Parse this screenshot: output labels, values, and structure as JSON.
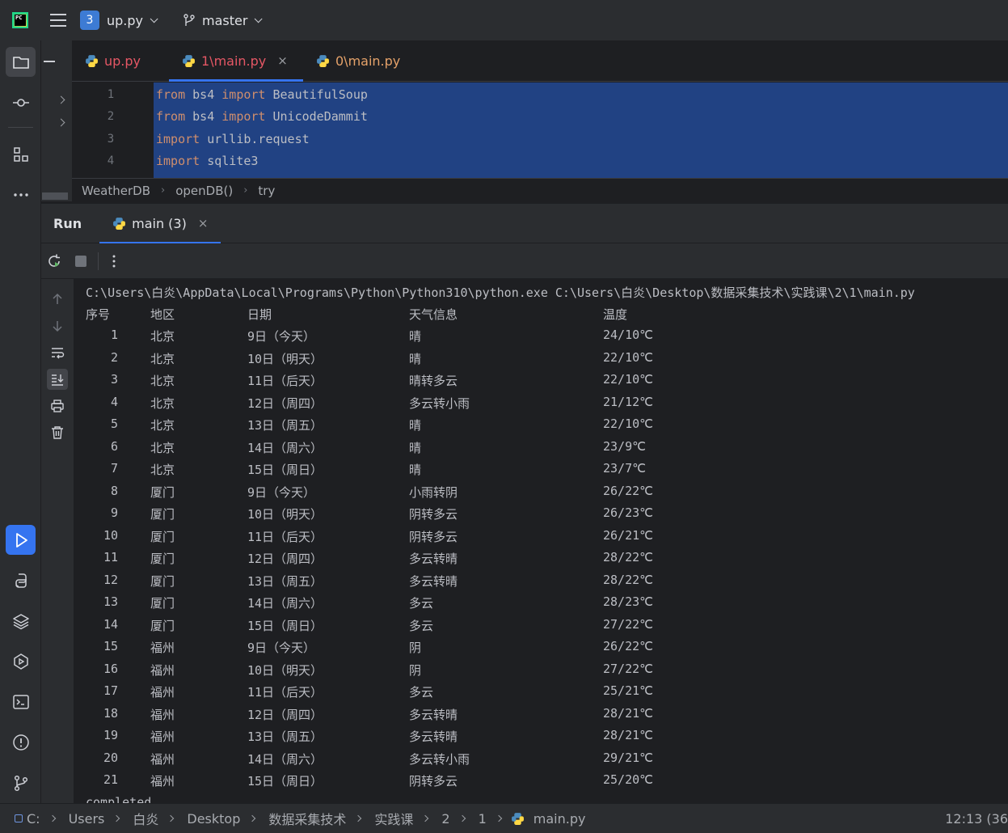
{
  "titlebar": {
    "logo_text": "PC",
    "project_badge": "3",
    "project_name": "up.py",
    "branch": "master"
  },
  "editor": {
    "tabs": [
      {
        "label": "up.py",
        "color": "#e55765",
        "active": false
      },
      {
        "label": "1\\main.py",
        "color": "#e55765",
        "active": true
      },
      {
        "label": "0\\main.py",
        "color": "#e5a26a",
        "active": false
      }
    ],
    "tab_close": "×",
    "line_numbers": [
      "1",
      "2",
      "3",
      "4"
    ],
    "lines": [
      {
        "kw1": "from",
        "mid": " bs4 ",
        "kw2": "import",
        "rest": " BeautifulSoup"
      },
      {
        "kw1": "from",
        "mid": " bs4 ",
        "kw2": "import",
        "rest": " UnicodeDammit"
      },
      {
        "kw1": "import",
        "rest": " urllib.request"
      },
      {
        "kw1": "import",
        "rest": " sqlite3"
      }
    ],
    "breadcrumbs": [
      "WeatherDB",
      "openDB()",
      "try"
    ]
  },
  "run": {
    "title": "Run",
    "tab_label": "main (3)",
    "tab_close": "×",
    "command": "C:\\Users\\白炎\\AppData\\Local\\Programs\\Python\\Python310\\python.exe C:\\Users\\白炎\\Desktop\\数据采集技术\\实践课\\2\\1\\main.py",
    "headers": {
      "idx": "序号",
      "city": "地区",
      "date": "日期",
      "weather": "天气信息",
      "temp": "温度"
    },
    "rows": [
      {
        "idx": "1",
        "city": "北京",
        "date": "9日（今天）",
        "weather": "晴",
        "temp": "24/10℃"
      },
      {
        "idx": "2",
        "city": "北京",
        "date": "10日（明天）",
        "weather": "晴",
        "temp": "22/10℃"
      },
      {
        "idx": "3",
        "city": "北京",
        "date": "11日（后天）",
        "weather": "晴转多云",
        "temp": "22/10℃"
      },
      {
        "idx": "4",
        "city": "北京",
        "date": "12日（周四）",
        "weather": "多云转小雨",
        "temp": "21/12℃"
      },
      {
        "idx": "5",
        "city": "北京",
        "date": "13日（周五）",
        "weather": "晴",
        "temp": "22/10℃"
      },
      {
        "idx": "6",
        "city": "北京",
        "date": "14日（周六）",
        "weather": "晴",
        "temp": "23/9℃"
      },
      {
        "idx": "7",
        "city": "北京",
        "date": "15日（周日）",
        "weather": "晴",
        "temp": "23/7℃"
      },
      {
        "idx": "8",
        "city": "厦门",
        "date": "9日（今天）",
        "weather": "小雨转阴",
        "temp": "26/22℃"
      },
      {
        "idx": "9",
        "city": "厦门",
        "date": "10日（明天）",
        "weather": "阴转多云",
        "temp": "26/23℃"
      },
      {
        "idx": "10",
        "city": "厦门",
        "date": "11日（后天）",
        "weather": "阴转多云",
        "temp": "26/21℃"
      },
      {
        "idx": "11",
        "city": "厦门",
        "date": "12日（周四）",
        "weather": "多云转晴",
        "temp": "28/22℃"
      },
      {
        "idx": "12",
        "city": "厦门",
        "date": "13日（周五）",
        "weather": "多云转晴",
        "temp": "28/22℃"
      },
      {
        "idx": "13",
        "city": "厦门",
        "date": "14日（周六）",
        "weather": "多云",
        "temp": "28/23℃"
      },
      {
        "idx": "14",
        "city": "厦门",
        "date": "15日（周日）",
        "weather": "多云",
        "temp": "27/22℃"
      },
      {
        "idx": "15",
        "city": "福州",
        "date": "9日（今天）",
        "weather": "阴",
        "temp": "26/22℃"
      },
      {
        "idx": "16",
        "city": "福州",
        "date": "10日（明天）",
        "weather": "阴",
        "temp": "27/22℃"
      },
      {
        "idx": "17",
        "city": "福州",
        "date": "11日（后天）",
        "weather": "多云",
        "temp": "25/21℃"
      },
      {
        "idx": "18",
        "city": "福州",
        "date": "12日（周四）",
        "weather": "多云转晴",
        "temp": "28/21℃"
      },
      {
        "idx": "19",
        "city": "福州",
        "date": "13日（周五）",
        "weather": "多云转晴",
        "temp": "28/21℃"
      },
      {
        "idx": "20",
        "city": "福州",
        "date": "14日（周六）",
        "weather": "多云转小雨",
        "temp": "29/21℃"
      },
      {
        "idx": "21",
        "city": "福州",
        "date": "15日（周日）",
        "weather": "阴转多云",
        "temp": "25/20℃"
      }
    ],
    "trailing_text": "completed"
  },
  "statusbar": {
    "path": [
      "C:",
      "Users",
      "白炎",
      "Desktop",
      "数据采集技术",
      "实践课",
      "2",
      "1",
      "main.py"
    ],
    "position": "12:13 (36"
  },
  "icons": {
    "leftbar": [
      "folder-icon",
      "commit-icon",
      "structure-icon",
      "more-icon",
      "run-icon",
      "python-console-icon",
      "layers-icon",
      "services-icon",
      "terminal-icon",
      "problems-icon",
      "git-icon"
    ],
    "console_side": [
      "arrow-up-icon",
      "arrow-down-icon",
      "soft-wrap-icon",
      "scroll-to-end-icon",
      "print-icon",
      "trash-icon"
    ]
  },
  "colors": {
    "accent": "#3574f0",
    "selection": "#214283",
    "keyword": "#cf8e6d"
  }
}
